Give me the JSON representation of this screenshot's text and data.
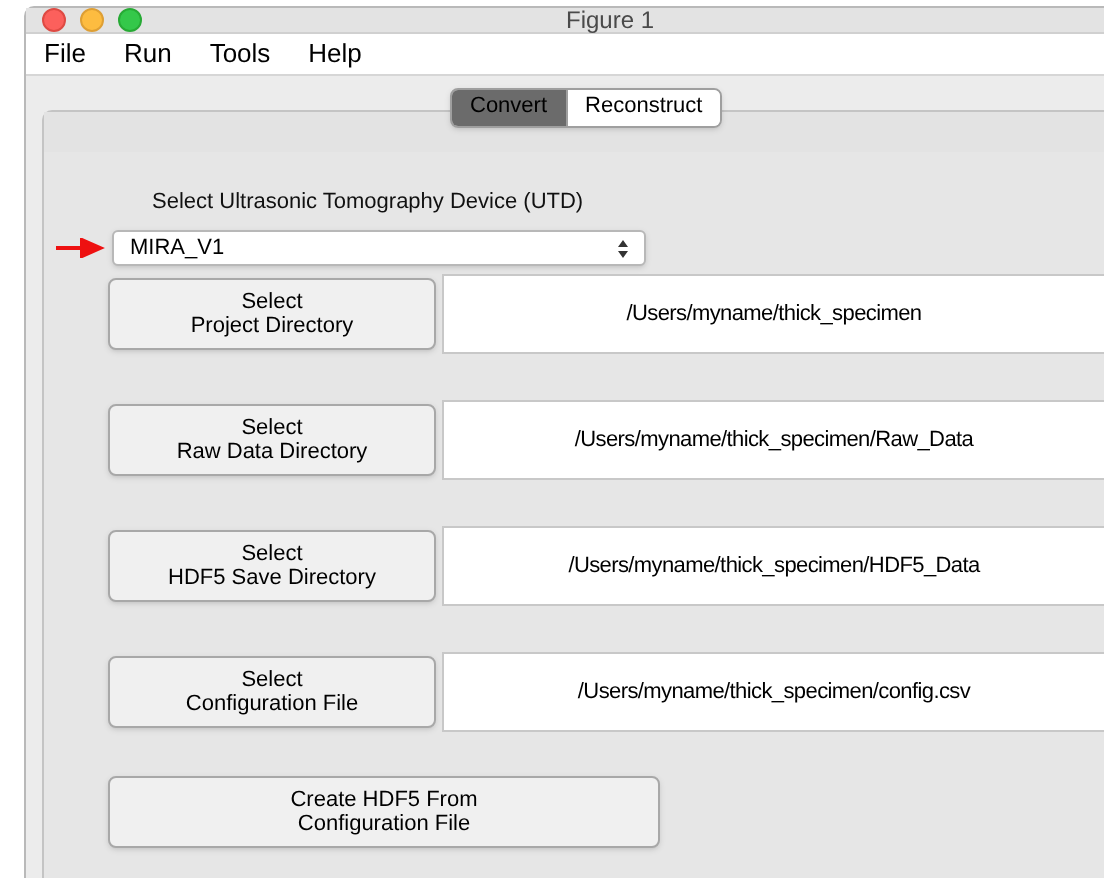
{
  "window": {
    "title": "Figure 1"
  },
  "menu": [
    "File",
    "Run",
    "Tools",
    "Help"
  ],
  "tabs": [
    {
      "label": "Convert",
      "selected": true
    },
    {
      "label": "Reconstruct",
      "selected": false
    }
  ],
  "device": {
    "label": "Select Ultrasonic Tomography Device (UTD)",
    "value": "MIRA_V1"
  },
  "rows": [
    {
      "button": "Select\nProject Directory",
      "path": "/Users/myname/thick_specimen"
    },
    {
      "button": "Select\nRaw Data Directory",
      "path": "/Users/myname/thick_specimen/Raw_Data"
    },
    {
      "button": "Select\nHDF5 Save Directory",
      "path": "/Users/myname/thick_specimen/HDF5_Data"
    },
    {
      "button": "Select\nConfiguration File",
      "path": "/Users/myname/thick_specimen/config.csv"
    }
  ],
  "create_button": "Create HDF5 From\nConfiguration File"
}
